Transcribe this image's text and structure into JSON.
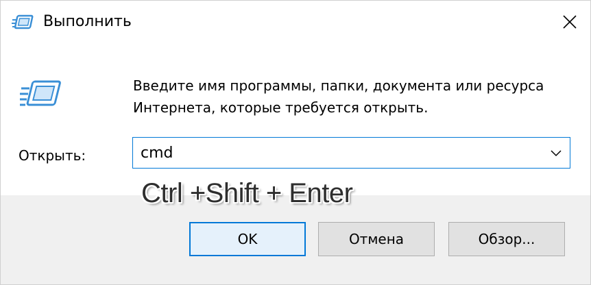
{
  "window": {
    "title": "Выполнить"
  },
  "icons": {
    "title_icon": "run-dialog-icon",
    "large_icon": "run-dialog-icon",
    "close": "close-icon",
    "dropdown": "chevron-down-icon"
  },
  "description": {
    "line1": "Введите имя программы, папки, документа или ресурса",
    "line2": "Интернета, которые требуется открыть."
  },
  "open_field": {
    "label": "Открыть:",
    "value": "cmd"
  },
  "overlay": {
    "text": "Ctrl +Shift + Enter"
  },
  "buttons": {
    "ok": "OK",
    "cancel": "Отмена",
    "browse": "Обзор..."
  },
  "colors": {
    "accent": "#0078d7",
    "footer_bg": "#f0f0f0",
    "button_bg": "#e1e1e1",
    "icon_blue": "#3a8fd6"
  }
}
